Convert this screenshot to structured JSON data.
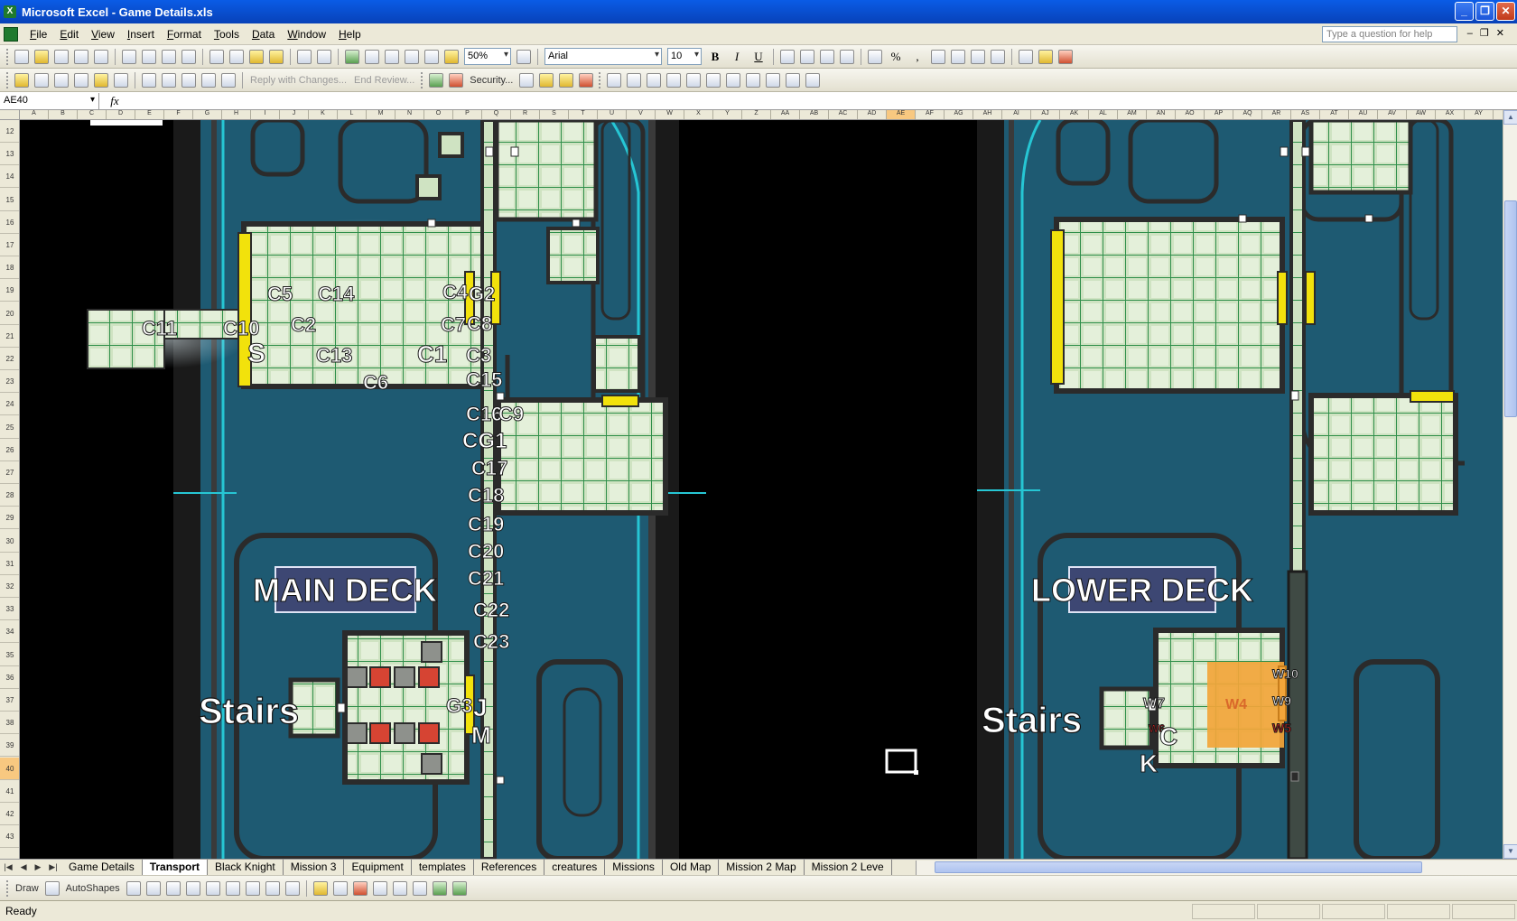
{
  "window": {
    "title": "Microsoft Excel - Game Details.xls",
    "app_icon": "excel-icon"
  },
  "menu": {
    "items": [
      "File",
      "Edit",
      "View",
      "Insert",
      "Format",
      "Tools",
      "Data",
      "Window",
      "Help"
    ],
    "help_placeholder": "Type a question for help"
  },
  "toolbar": {
    "zoom": "50%",
    "font": "Arial",
    "font_size": "10",
    "bold": "B",
    "italic": "I",
    "underline": "U",
    "percent": "%",
    "comma": ",",
    "reply_label": "Reply with Changes...",
    "end_review_label": "End Review...",
    "security_label": "Security..."
  },
  "formula": {
    "name_box": "AE40",
    "fx": "fx",
    "content": ""
  },
  "columns": [
    "A",
    "B",
    "C",
    "D",
    "E",
    "F",
    "G",
    "H",
    "I",
    "J",
    "K",
    "L",
    "M",
    "N",
    "O",
    "P",
    "Q",
    "R",
    "S",
    "T",
    "U",
    "V",
    "W",
    "X",
    "Y",
    "Z",
    "AA",
    "AB",
    "AC",
    "AD",
    "AE",
    "AF",
    "AG",
    "AH",
    "AI",
    "AJ",
    "AK",
    "AL",
    "AM",
    "AN",
    "AO",
    "AP",
    "AQ",
    "AR",
    "AS",
    "AT",
    "AU",
    "AV",
    "AW",
    "AX",
    "AY"
  ],
  "selected_column": "AE",
  "rows": [
    "12",
    "13",
    "14",
    "15",
    "16",
    "17",
    "18",
    "19",
    "20",
    "21",
    "22",
    "23",
    "24",
    "25",
    "26",
    "27",
    "28",
    "29",
    "30",
    "31",
    "32",
    "33",
    "34",
    "35",
    "36",
    "37",
    "38",
    "39",
    "40",
    "41",
    "42",
    "43"
  ],
  "selected_row": "40",
  "map": {
    "main_deck_label": "MAIN DECK",
    "lower_deck_label": "LOWER DECK",
    "stairs_label": "Stairs",
    "main_labels": [
      "C5",
      "C14",
      "C4",
      "G2",
      "C11",
      "C10",
      "C2",
      "C7",
      "C8",
      "S",
      "C13",
      "C1",
      "C3",
      "C6",
      "C15",
      "C16",
      "C9",
      "CG1",
      "C17",
      "C18",
      "C19",
      "C20",
      "C21",
      "C22",
      "C23",
      "G3",
      "J",
      "M"
    ],
    "lower_labels": [
      "W7",
      "W4",
      "W10",
      "W9",
      "W5",
      "W6",
      "C",
      "K"
    ],
    "colors": {
      "hull": "#1e5a72",
      "floor": "#cfe3c2",
      "grid_line": "#2f8f4a",
      "door": "#f2e20c",
      "accent_orange": "#f2a53a",
      "red_tile": "#d64433",
      "wall": "#2b2b2b",
      "outline": "#26c6d4"
    }
  },
  "sheet_tabs": [
    "Game Details",
    "Transport",
    "Black Knight",
    "Mission 3",
    "Equipment",
    "templates",
    "References",
    "creatures",
    "Missions",
    "Old Map",
    "Mission 2 Map",
    "Mission 2 Leve"
  ],
  "active_tab": "Transport",
  "draw": {
    "draw_label": "Draw",
    "autoshapes_label": "AutoShapes"
  },
  "status": {
    "text": "Ready"
  }
}
